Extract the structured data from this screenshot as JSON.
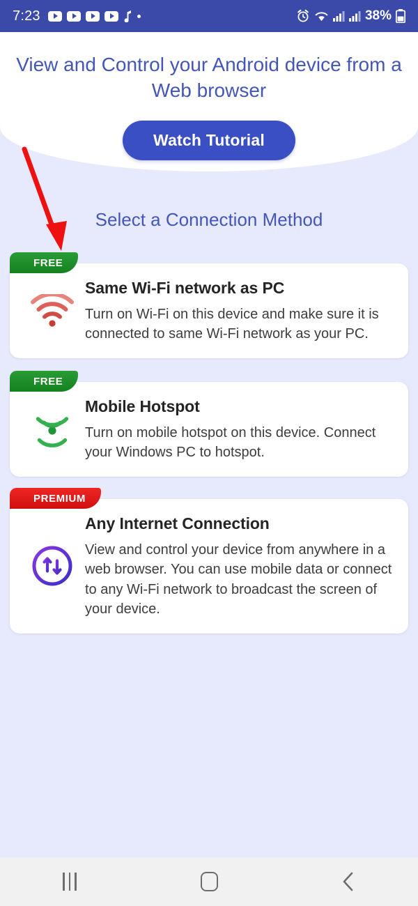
{
  "status_bar": {
    "time": "7:23",
    "battery_percent": "38%",
    "left_icons": [
      "youtube-icon",
      "youtube-icon",
      "youtube-icon",
      "youtube-icon",
      "music-note-icon",
      "dot-icon"
    ],
    "right_icons": [
      "alarm-icon",
      "wifi-icon",
      "signal-icon",
      "signal-icon",
      "battery-icon"
    ],
    "background_color": "#3b4aa8"
  },
  "header": {
    "headline": "View and Control your Android device from a Web browser",
    "watch_tutorial_label": "Watch Tutorial",
    "button_color": "#3b4fc4",
    "headline_color": "#4456b8"
  },
  "main": {
    "section_title": "Select a Connection Method",
    "background_color": "#e7e9fd",
    "cards": [
      {
        "badge": "FREE",
        "badge_type": "free",
        "badge_color": "#14811f",
        "icon": "wifi-icon",
        "icon_color": "#d9453f",
        "title": "Same Wi-Fi network as PC",
        "description": "Turn on Wi-Fi on this device and make sure it is connected to same Wi-Fi network as your PC."
      },
      {
        "badge": "FREE",
        "badge_type": "free",
        "badge_color": "#14811f",
        "icon": "hotspot-icon",
        "icon_color": "#27a03c",
        "title": "Mobile Hotspot",
        "description": "Turn on mobile hotspot on this device. Connect your Windows PC to hotspot."
      },
      {
        "badge": "PREMIUM",
        "badge_type": "premium",
        "badge_color": "#cf0f0f",
        "icon": "data-transfer-icon",
        "icon_color": "#6b2bd9",
        "title": "Any Internet Connection",
        "description": "View and control your device from anywhere in a web browser. You can use mobile data or connect to any Wi-Fi network to broadcast the screen of your device."
      }
    ]
  },
  "annotation": {
    "arrow": "red-arrow-annotation",
    "color": "#ee1111"
  },
  "nav_bar": {
    "buttons": [
      "recents-button",
      "home-button",
      "back-button"
    ],
    "background_color": "#f1f1f1"
  }
}
